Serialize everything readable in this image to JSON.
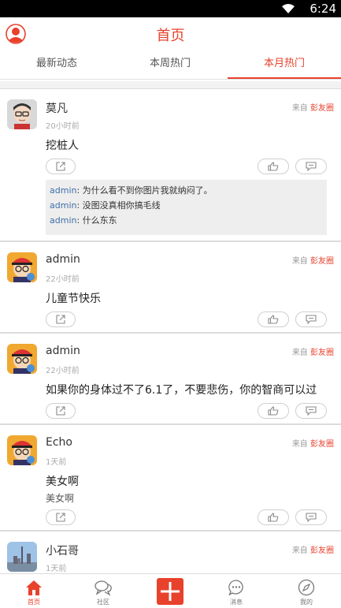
{
  "status_bar": {
    "time": "6:24"
  },
  "header": {
    "title": "首页"
  },
  "tabs": [
    {
      "label": "最新动态",
      "active": false
    },
    {
      "label": "本周热门",
      "active": false
    },
    {
      "label": "本月热门",
      "active": true
    }
  ],
  "posts": [
    {
      "name": "莫凡",
      "time": "20小时前",
      "source_prefix": "来自",
      "source_name": "彭友圈",
      "content": "挖桩人",
      "comments": [
        {
          "user": "admin",
          "text": ": 为什么看不到你图片我就纳闷了。"
        },
        {
          "user": "admin",
          "text": ": 没图没真相你搞毛线"
        },
        {
          "user": "admin",
          "text": ": 什么东东"
        }
      ]
    },
    {
      "name": "admin",
      "time": "22小时前",
      "source_prefix": "来自",
      "source_name": "彭友圈",
      "content": "儿童节快乐"
    },
    {
      "name": "admin",
      "time": "22小时前",
      "source_prefix": "来自",
      "source_name": "彭友圈",
      "content": "如果你的身体过不了6.1了，不要悲伤，你的智商可以过"
    },
    {
      "name": "Echo",
      "time": "1天前",
      "source_prefix": "来自",
      "source_name": "彭友圈",
      "content": "美女啊",
      "subtext": "美女啊"
    },
    {
      "name": "小石哥",
      "time": "1天前",
      "source_prefix": "来自",
      "source_name": "彭友圈"
    }
  ],
  "bottom_nav": [
    {
      "label": "首页",
      "icon": "home-icon",
      "active": true
    },
    {
      "label": "社区",
      "icon": "community-icon",
      "active": false
    },
    {
      "label": "",
      "icon": "add-icon",
      "active": false
    },
    {
      "label": "消息",
      "icon": "message-icon",
      "active": false
    },
    {
      "label": "我的",
      "icon": "compass-icon",
      "active": false
    }
  ],
  "colors": {
    "accent": "#e8412c",
    "comment_user": "#3d6ea8",
    "divider": "#dcdcdc"
  }
}
